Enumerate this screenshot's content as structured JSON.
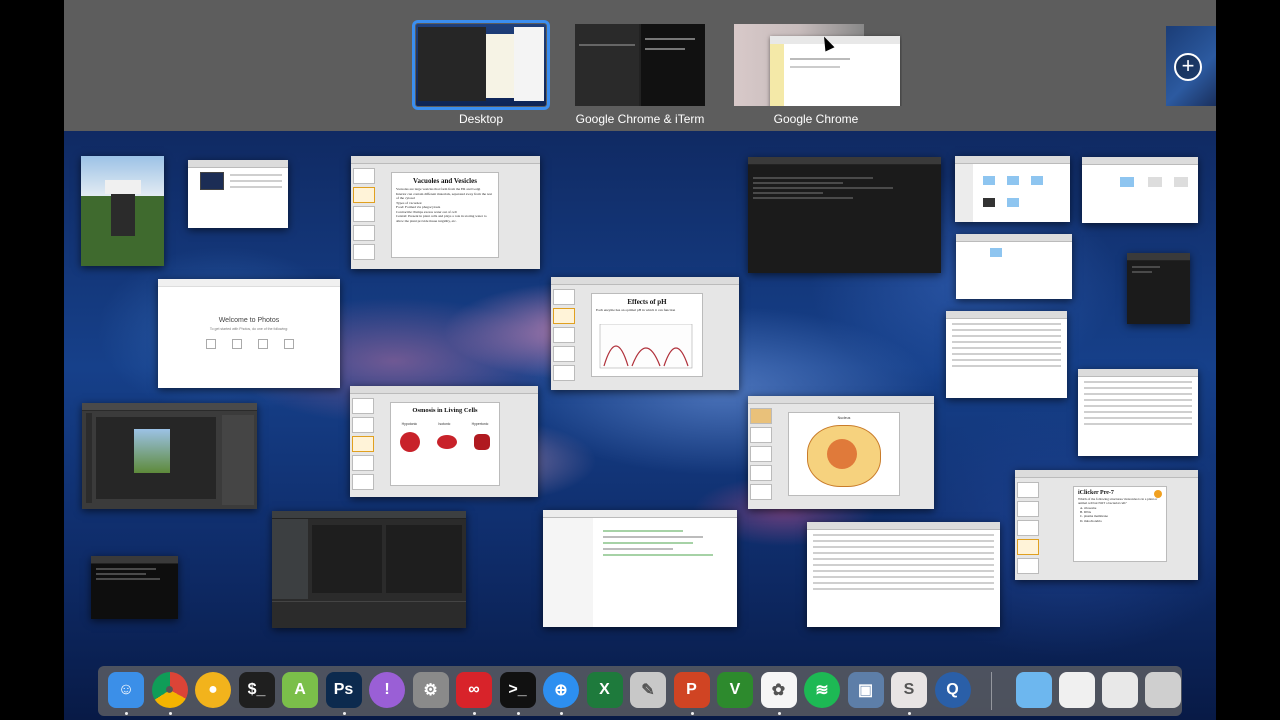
{
  "spaces": [
    {
      "label": "Desktop",
      "active": true
    },
    {
      "label": "Google Chrome & iTerm",
      "active": false
    },
    {
      "label": "Google Chrome",
      "active": false
    }
  ],
  "add_space_symbol": "+",
  "windows": {
    "vacuoles": {
      "title": "Vacuoles and Vesicles",
      "bullets": [
        "Vacuoles are large vesicles that form from the ER and Golgi",
        "Interior can contain different materials, separated away from the rest of the cytosol",
        "Types of vacuoles:",
        "Food: Formed via phagocytosis",
        "Contractile: Pumps excess water out of cell",
        "Central: Present in plant cells and plays a role in storing water to allow the plant provide tissue turgidity, etc."
      ]
    },
    "ph": {
      "title": "Effects of pH",
      "body": "Each enzyme has an optimal pH in which it can function"
    },
    "osmosis": {
      "title": "Osmosis in Living Cells",
      "labels": [
        "Hypotonic",
        "Isotonic",
        "Hypertonic"
      ]
    },
    "photos_welcome": {
      "title": "Welcome to Photos",
      "subtitle": "To get started with Photos, do one of the following:"
    },
    "iclicker": {
      "title": "iClicker Pre-7",
      "question": "Which of the following structures/ molecules is in a plant or animal cell but NOT a bacterial cell?",
      "options": [
        "A. ribosome",
        "B. DNA",
        "C. plasma membrane",
        "D. mitochondria"
      ]
    },
    "diagram": {
      "title": "Nucleus"
    }
  },
  "dock": {
    "items": [
      {
        "name": "finder",
        "glyph": "☺",
        "color": "#3b8fe8",
        "running": true
      },
      {
        "name": "chrome",
        "glyph": "●",
        "color": "#ffffff",
        "running": true
      },
      {
        "name": "chrome-canary",
        "glyph": "●",
        "color": "#f2b31c",
        "running": false
      },
      {
        "name": "terminal",
        "glyph": "$_",
        "color": "#1f1f1f",
        "running": false
      },
      {
        "name": "android-studio",
        "glyph": "A",
        "color": "#7bbf4a",
        "running": false
      },
      {
        "name": "photoshop",
        "glyph": "Ps",
        "color": "#0c2a4e",
        "running": true
      },
      {
        "name": "app-purple",
        "glyph": "!",
        "color": "#9a5fd6",
        "running": false
      },
      {
        "name": "system-preferences",
        "glyph": "⚙",
        "color": "#8a8a8a",
        "running": false
      },
      {
        "name": "creative-cloud",
        "glyph": "∞",
        "color": "#d8232a",
        "running": true
      },
      {
        "name": "iterm",
        "glyph": ">_",
        "color": "#111111",
        "running": true
      },
      {
        "name": "safari",
        "glyph": "⊕",
        "color": "#2d8ff0",
        "running": true
      },
      {
        "name": "excel",
        "glyph": "X",
        "color": "#1e7a3c",
        "running": false
      },
      {
        "name": "keychain",
        "glyph": "✎",
        "color": "#c8c8c8",
        "running": false
      },
      {
        "name": "powerpoint",
        "glyph": "P",
        "color": "#d04423",
        "running": true
      },
      {
        "name": "vim",
        "glyph": "V",
        "color": "#2d8a2d",
        "running": false
      },
      {
        "name": "photos",
        "glyph": "✿",
        "color": "#f6f6f6",
        "running": true
      },
      {
        "name": "spotify",
        "glyph": "≋",
        "color": "#1db954",
        "running": false
      },
      {
        "name": "preview",
        "glyph": "▣",
        "color": "#5d7ea8",
        "running": false
      },
      {
        "name": "slack",
        "glyph": "S",
        "color": "#e8e4e4",
        "running": true
      },
      {
        "name": "quicktime",
        "glyph": "Q",
        "color": "#2a5fa8",
        "running": false
      },
      {
        "name": "downloads-folder",
        "glyph": "",
        "color": "#6db7ef",
        "running": false
      },
      {
        "name": "recent-docs",
        "glyph": "",
        "color": "#f0f0f0",
        "running": false
      },
      {
        "name": "recent-apps",
        "glyph": "",
        "color": "#e8e8e8",
        "running": false
      },
      {
        "name": "trash",
        "glyph": "",
        "color": "#cfcfcf",
        "running": false
      }
    ]
  }
}
